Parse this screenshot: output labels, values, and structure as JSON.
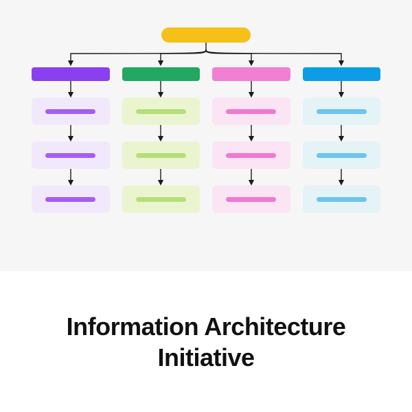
{
  "title": "Information Architecture Initiative",
  "diagram": {
    "root": {
      "color": "#f6c01a",
      "label": ""
    },
    "columns": [
      {
        "id": "purple",
        "header_color": "#8a3ff0",
        "sub_fill": "#f2e8fc",
        "bar_color": "#a360ee",
        "sub_count": 3
      },
      {
        "id": "green",
        "header_color": "#22a860",
        "sub_fill": "#eaf5d0",
        "bar_color": "#b6de79",
        "sub_count": 3
      },
      {
        "id": "pink",
        "header_color": "#f17fd2",
        "sub_fill": "#fbe4f4",
        "bar_color": "#ef7ace",
        "sub_count": 3
      },
      {
        "id": "blue",
        "header_color": "#0b9de6",
        "sub_fill": "#e4f3f6",
        "bar_color": "#6ec4ed",
        "sub_count": 3
      }
    ]
  }
}
